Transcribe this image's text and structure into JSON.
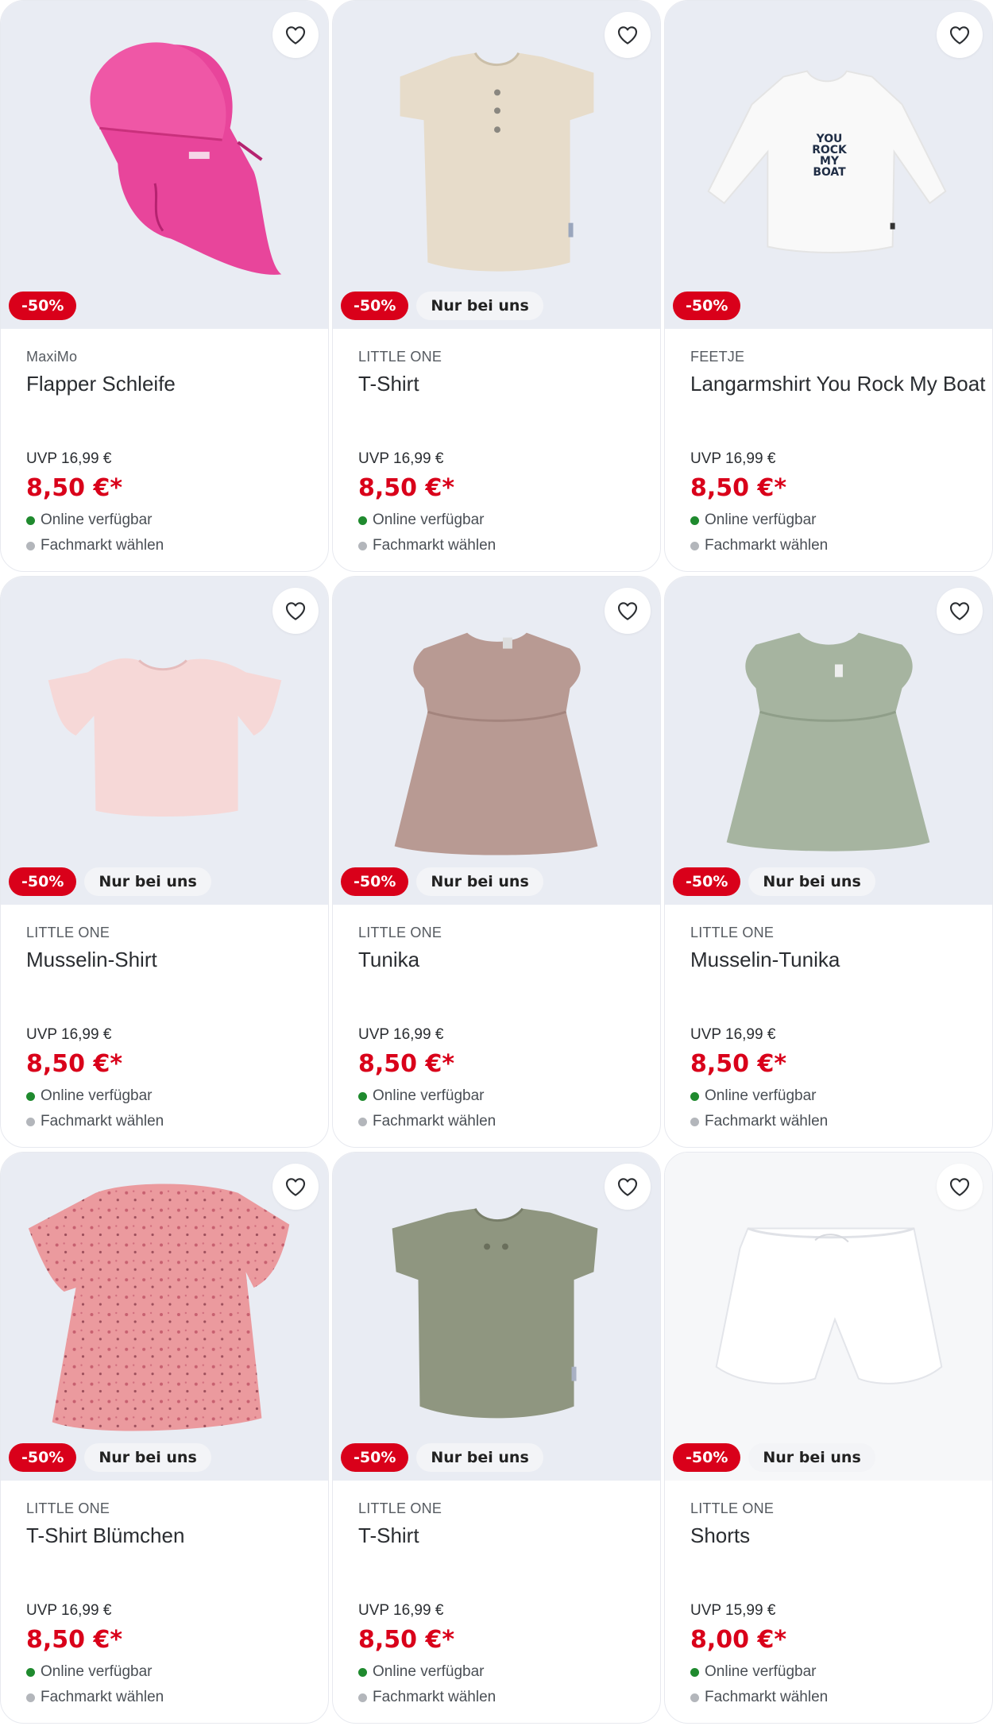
{
  "colors": {
    "sale": "#d9001a",
    "available": "#1f8a2e",
    "store": "#b3b6bb",
    "image_bg": "#e9ecf3"
  },
  "labels": {
    "online": "Online verfügbar",
    "store": "Fachmarkt wählen",
    "wishlist_icon": "heart-outline-icon"
  },
  "products": [
    {
      "brand": "MaxiMo",
      "name": "Flapper Schleife",
      "discount": "-50%",
      "exclusive": "",
      "uvp": "UVP 16,99 €",
      "price": "8,50 €*",
      "image": "pink-sun-hat"
    },
    {
      "brand": "LITTLE ONE",
      "name": "T-Shirt",
      "discount": "-50%",
      "exclusive": "Nur bei uns",
      "uvp": "UVP 16,99 €",
      "price": "8,50 €*",
      "image": "beige-tshirt"
    },
    {
      "brand": "FEETJE",
      "name": "Langarmshirt You Rock My Boat",
      "discount": "-50%",
      "exclusive": "",
      "uvp": "UVP 16,99 €",
      "price": "8,50 €*",
      "image": "white-longsleeve",
      "print_text": "YOU ROCK MY BOAT"
    },
    {
      "brand": "LITTLE ONE",
      "name": "Musselin-Shirt",
      "discount": "-50%",
      "exclusive": "Nur bei uns",
      "uvp": "UVP 16,99 €",
      "price": "8,50 €*",
      "image": "light-pink-shirt"
    },
    {
      "brand": "LITTLE ONE",
      "name": "Tunika",
      "discount": "-50%",
      "exclusive": "Nur bei uns",
      "uvp": "UVP 16,99 €",
      "price": "8,50 €*",
      "image": "mauve-tunic"
    },
    {
      "brand": "LITTLE ONE",
      "name": "Musselin-Tunika",
      "discount": "-50%",
      "exclusive": "Nur bei uns",
      "uvp": "UVP 16,99 €",
      "price": "8,50 €*",
      "image": "sage-tunic"
    },
    {
      "brand": "LITTLE ONE",
      "name": "T-Shirt Blümchen",
      "discount": "-50%",
      "exclusive": "Nur bei uns",
      "uvp": "UVP 16,99 €",
      "price": "8,50 €*",
      "image": "pink-floral-shirt"
    },
    {
      "brand": "LITTLE ONE",
      "name": "T-Shirt",
      "discount": "-50%",
      "exclusive": "Nur bei uns",
      "uvp": "UVP 16,99 €",
      "price": "8,50 €*",
      "image": "olive-tshirt"
    },
    {
      "brand": "LITTLE ONE",
      "name": "Shorts",
      "discount": "-50%",
      "exclusive": "Nur bei uns",
      "uvp": "UVP 15,99 €",
      "price": "8,00 €*",
      "image": "white-shorts"
    }
  ]
}
